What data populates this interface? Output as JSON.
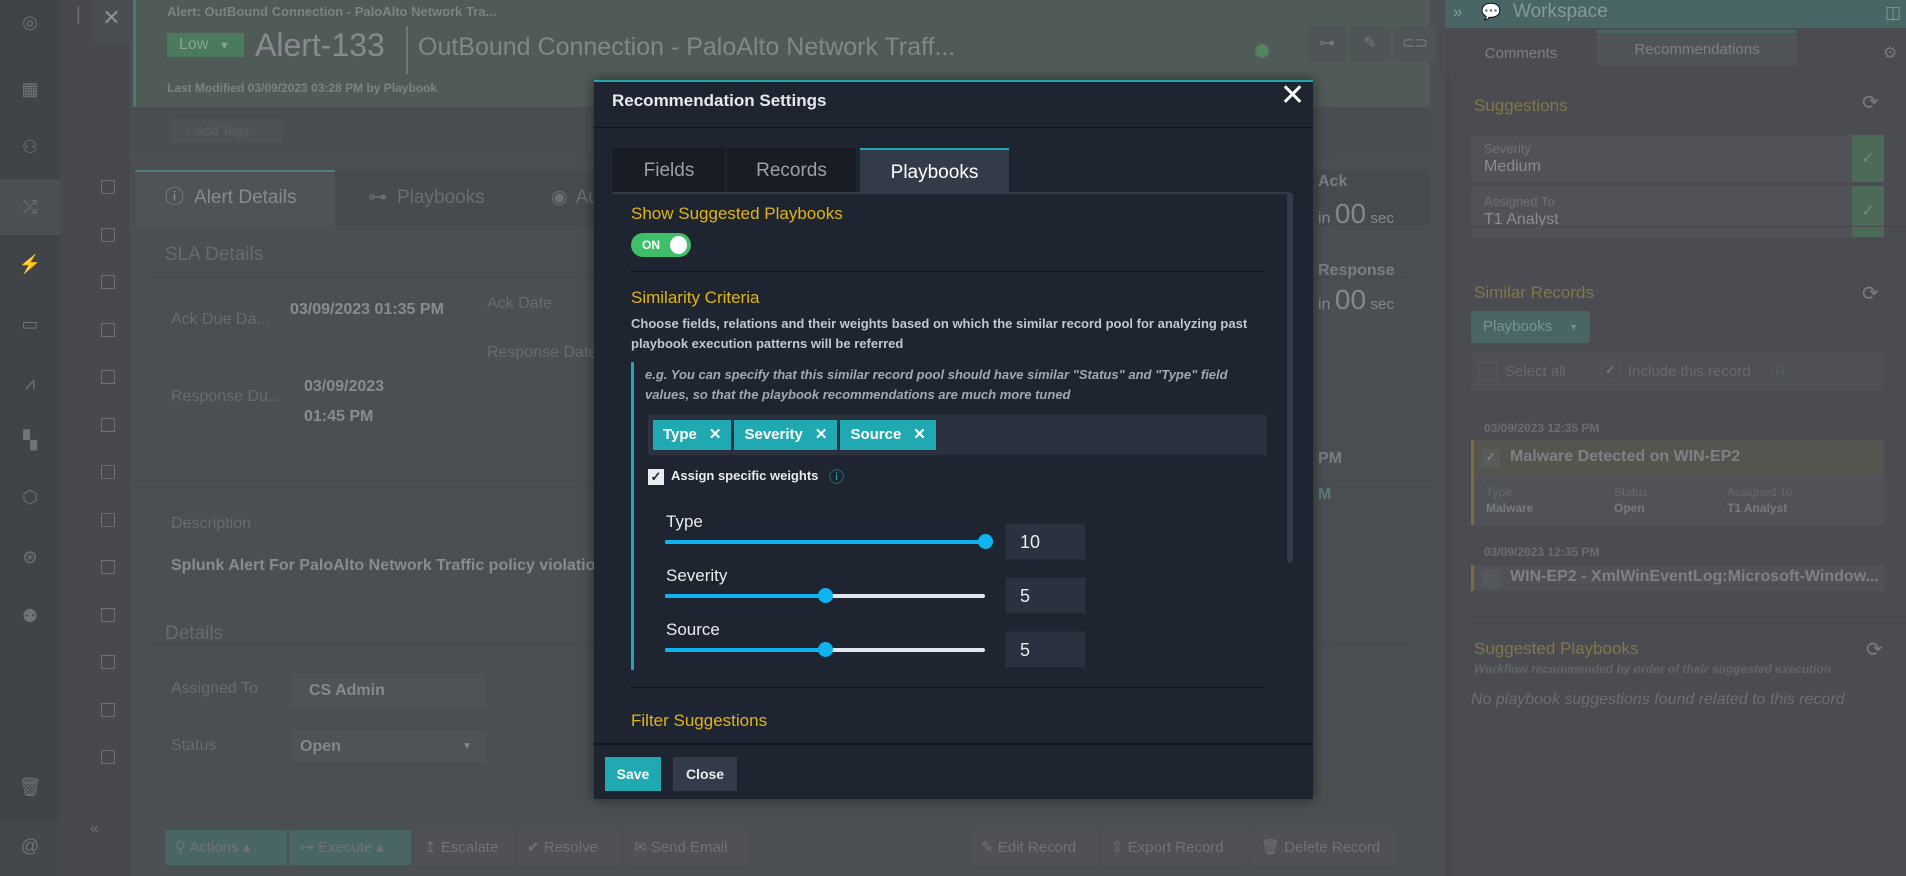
{
  "sidebar": {
    "icons": [
      "logo-icon",
      "dashboard-icon",
      "teams-icon",
      "shuffle-icon",
      "incident-icon",
      "briefcase-icon",
      "analytics-icon",
      "widgets-icon",
      "connector-icon",
      "support-icon",
      "users-icon",
      "trash-icon",
      "at-icon"
    ]
  },
  "header": {
    "breadcrumb": "Alert: OutBound Connection - PaloAlto Network Tra...",
    "severity": "Low",
    "record_id": "Alert-133",
    "title": "OutBound Connection - PaloAlto Network Traff...",
    "last_modified": "Last Modified 03/09/2023 03:28 PM by Playbook",
    "add_tags": "+ Add Tags"
  },
  "tabs": [
    {
      "label": "Alert Details"
    },
    {
      "label": "Playbooks"
    },
    {
      "label": "Au"
    }
  ],
  "sla": {
    "title": "SLA Details",
    "ack_due_label": "Ack Due Da...",
    "ack_due_value": "03/09/2023 01:35 PM",
    "ack_date_label": "Ack Date",
    "response_date_label": "Response Date",
    "response_due_label": "Response Du...",
    "response_due_value": "03/09/2023 01:45 PM",
    "ack_timer_label": "Ack",
    "ack_timer": {
      "prefix": "in",
      "num": "00",
      "unit": "sec"
    },
    "response_timer_label": "Response",
    "response_timer": {
      "prefix": "in",
      "num": "00",
      "unit": "sec"
    },
    "side_a": "PM",
    "side_b": "M"
  },
  "description": {
    "label": "Description",
    "text": "Splunk Alert For PaloAlto Network Traffic policy violation"
  },
  "details": {
    "title": "Details",
    "assigned_label": "Assigned To",
    "assigned_value": "CS Admin",
    "status_label": "Status",
    "status_value": "Open"
  },
  "actions": {
    "actions": "Actions",
    "execute": "Execute",
    "escalate": "Escalate",
    "resolve": "Resolve",
    "send_email": "Send Email",
    "edit": "Edit Record",
    "export": "Export Record",
    "delete": "Delete Record"
  },
  "workspace": {
    "title": "Workspace",
    "tabs": [
      "Comments",
      "Recommendations"
    ],
    "suggestions_title": "Suggestions",
    "suggestions": [
      {
        "label": "Severity",
        "value": "Medium"
      },
      {
        "label": "Assigned To",
        "value": "T1 Analyst"
      }
    ],
    "similar_title": "Similar Records",
    "similar_filter": "Playbooks",
    "select_all": "Select all",
    "include_record": "Include this record",
    "records": [
      {
        "date": "03/09/2023 12:35 PM",
        "title": "Malware Detected on WIN-EP2",
        "checked": true,
        "fields": [
          {
            "label": "Type",
            "value": "Malware"
          },
          {
            "label": "Status",
            "value": "Open"
          },
          {
            "label": "Assigned To",
            "value": "T1 Analyst"
          }
        ]
      },
      {
        "date": "03/09/2023 12:35 PM",
        "title": "WIN-EP2 - XmlWinEventLog:Microsoft-Window..."
      }
    ],
    "suggested_playbooks_title": "Suggested Playbooks",
    "suggested_playbooks_subtitle": "Workflow recommended by order of their suggested execution",
    "no_suggestions": "No playbook suggestions found related to this record"
  },
  "modal": {
    "title": "Recommendation Settings",
    "tabs": [
      "Fields",
      "Records",
      "Playbooks"
    ],
    "active_tab": "Playbooks",
    "show_title": "Show Suggested Playbooks",
    "toggle": "ON",
    "similarity_title": "Similarity Criteria",
    "similarity_desc": "Choose fields, relations and their weights based on which the similar record pool for analyzing past playbook execution patterns will be referred",
    "example": "e.g. You can specify that this similar record pool should have similar \"Status\" and \"Type\" field values, so that the playbook recommendations are much more tuned",
    "chips": [
      "Type",
      "Severity",
      "Source"
    ],
    "assign_weights": "Assign specific weights",
    "weight_max": 10,
    "weights": [
      {
        "label": "Type",
        "value": 10
      },
      {
        "label": "Severity",
        "value": 5
      },
      {
        "label": "Source",
        "value": 5
      }
    ],
    "filter_title": "Filter Suggestions",
    "save": "Save",
    "close": "Close"
  },
  "colors": {
    "accent": "#1fa8b0",
    "heading": "#e0b51a",
    "slider": "#0db4ef",
    "toggle": "#3fbf6a"
  }
}
